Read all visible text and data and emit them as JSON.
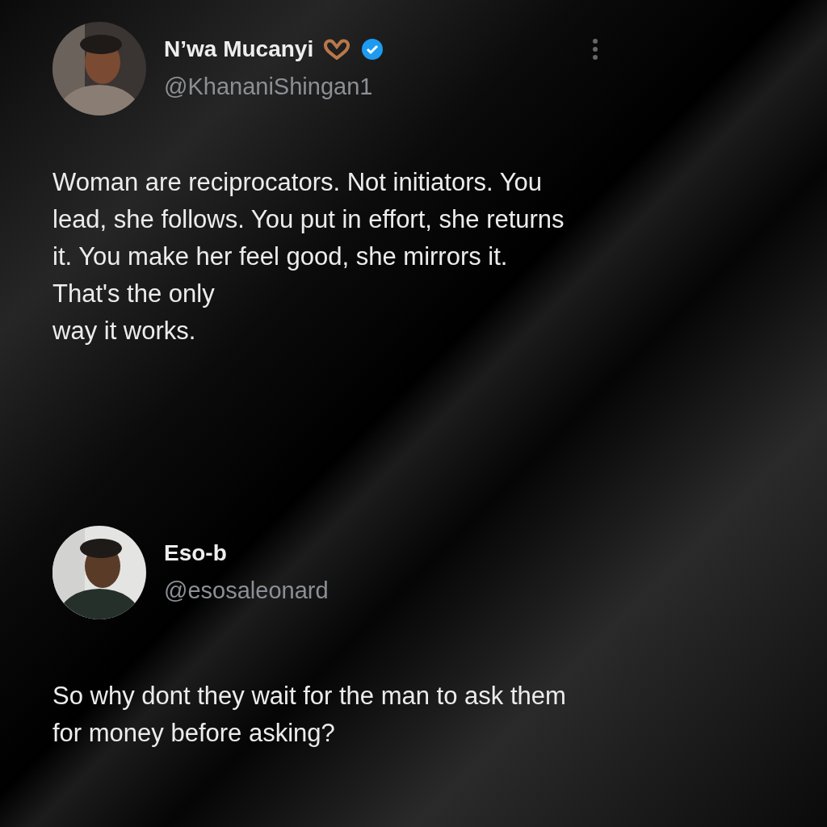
{
  "posts": [
    {
      "author": {
        "name": "N’wa Mucanyi",
        "handle": "@KhananiShingan1",
        "verified": true,
        "emoji": true
      },
      "menu": true,
      "text_lines": [
        "Woman are reciprocators. Not initiators. You",
        "lead, she follows. You put in effort, she returns",
        "it. You make her feel good, she mirrors it.",
        "That's the only",
        "way it works."
      ]
    },
    {
      "author": {
        "name": "Eso-b",
        "handle": "@esosaleonard",
        "verified": false,
        "emoji": false
      },
      "menu": false,
      "text_lines": [
        "So why dont they wait for the man to ask them",
        "for money before asking?"
      ]
    }
  ]
}
